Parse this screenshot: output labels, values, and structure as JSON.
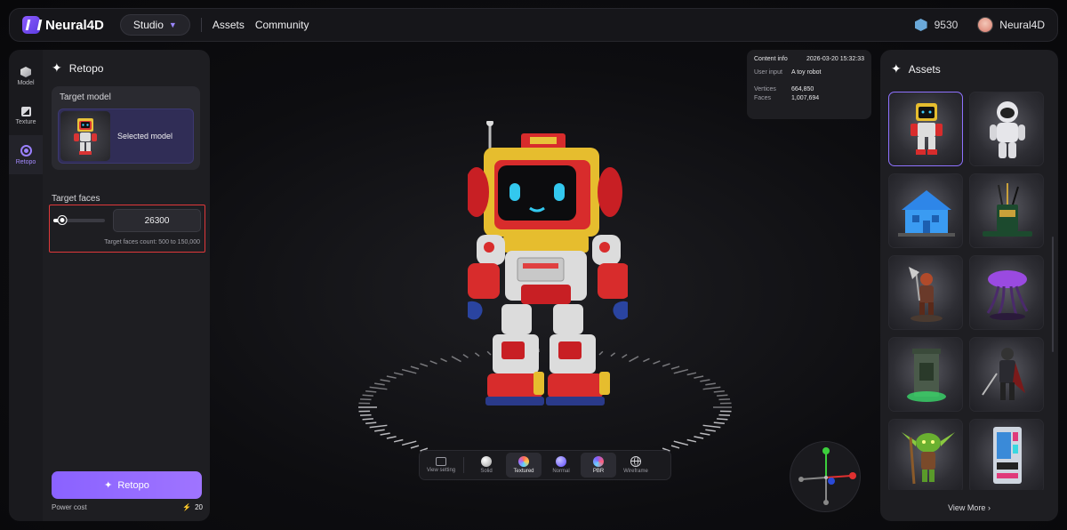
{
  "app": {
    "name": "Neural4D"
  },
  "topbar": {
    "studio_label": "Studio",
    "nav": [
      "Assets",
      "Community"
    ],
    "credits": "9530",
    "username": "Neural4D"
  },
  "rail": {
    "items": [
      "Model",
      "Texture",
      "Retopo"
    ],
    "active": "Retopo"
  },
  "retopo_panel": {
    "title": "Retopo",
    "target_model_label": "Target model",
    "selected_model_label": "Selected model",
    "target_faces_label": "Target faces",
    "target_faces_value": "26300",
    "slider_fraction": 0.172,
    "target_faces_hint": "Target faces count: 500 to 150,000",
    "button_label": "Retopo",
    "power_cost_label": "Power cost",
    "power_cost_value": "20"
  },
  "content_info": {
    "title": "Content info",
    "timestamp": "2026-03-20 15:32:33",
    "user_input_label": "User input",
    "user_input_value": "A toy robot",
    "vertices_label": "Vertices",
    "vertices_value": "664,850",
    "faces_label": "Faces",
    "faces_value": "1,007,694"
  },
  "view_toolbar": {
    "items": [
      "View setting",
      "Solid",
      "Textured",
      "Normal",
      "PBR",
      "Wireframe"
    ],
    "active": [
      "Textured",
      "PBR"
    ]
  },
  "assets_panel": {
    "title": "Assets",
    "items": [
      "toy robot",
      "astronaut",
      "blue house",
      "pen holder",
      "axe warrior",
      "purple jellyfish",
      "stone pillar",
      "dark knight",
      "goblin",
      "vending machine"
    ],
    "selected": "toy robot",
    "view_more": "View More"
  },
  "colors": {
    "accent": "#8f72ff",
    "highlight_border": "#e0383a",
    "background": "#0b0b0d"
  }
}
